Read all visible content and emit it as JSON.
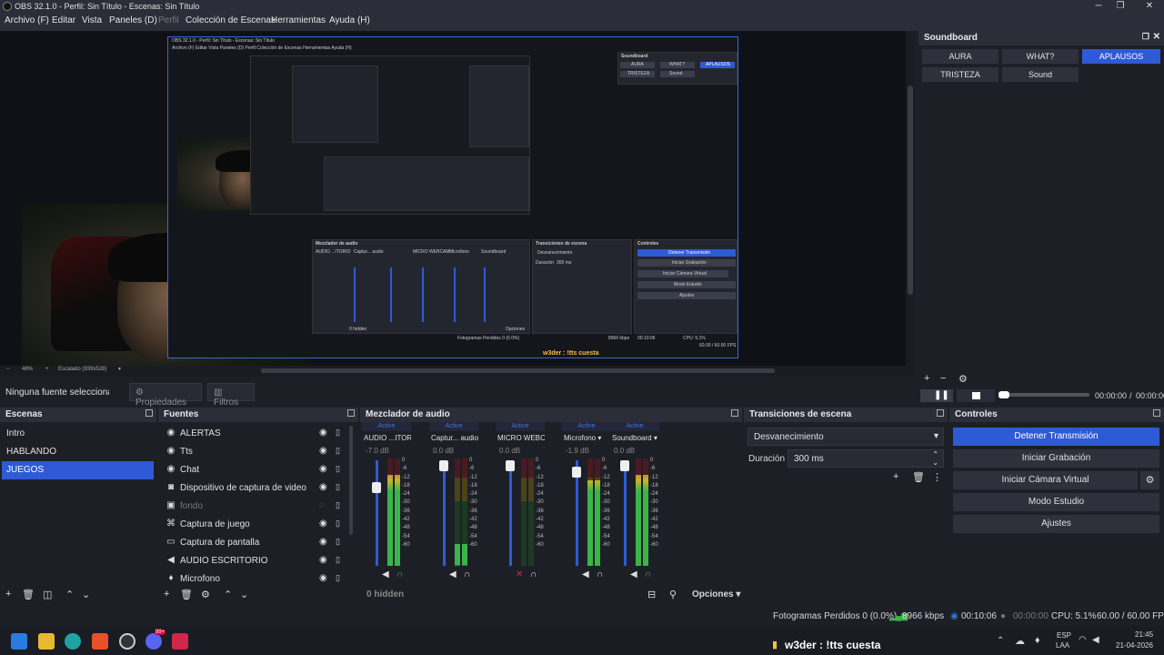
{
  "window": {
    "title": "OBS 32.1.0 - Perfil: Sin Título - Escenas: Sin Título",
    "minimize": "─",
    "maximize": "❐",
    "close": "✕"
  },
  "menu": {
    "items": [
      "Archivo (F)",
      "Editar",
      "Vista",
      "Paneles (D)",
      "Perfil",
      "Colección de Escenas",
      "Herramientas",
      "Ayuda (H)"
    ]
  },
  "preview": {
    "zoom": "48%",
    "zoom_minus": "−",
    "zoom_plus": "+",
    "scale_label": "Escalado (939x528)",
    "nested_title": "OBS 32.1.0 - Perfil: Sin Título - Escenas: Sin Título",
    "nested_menu": "Archivo (F)   Editar   Vista   Paneles (D)   Perfil   Colección de Escenas   Herramientas   Ayuda (H)",
    "nested_mixer_title": "Mezclador de audio",
    "nested_trans_title": "Transiciones de escena",
    "nested_controls_title": "Controles",
    "nested_stop": "Detener Transmisión",
    "nested_rec": "Iniciar Grabación",
    "nested_vcam": "Iniciar Cámara Virtual",
    "nested_studio": "Modo Estudio",
    "nested_settings": "Ajustes",
    "nested_soundboard": "Soundboard",
    "nested_aura": "AURA",
    "nested_what": "WHAT?",
    "nested_aplausos": "APLAUSOS",
    "nested_tristeza": "TRISTEZA",
    "nested_sound": "Sound",
    "nested_fade": "Desvanecimiento",
    "nested_duration": "Duración",
    "nested_duration_val": "300 ms",
    "nested_hidden": "0 hidden",
    "nested_options": "Opciones",
    "nested_dropped": "Fotogramas Perdidos 0 (0.0%)",
    "nested_kbps": "8966 kbps",
    "nested_time": "00:10:06",
    "nested_cpu": "CPU: 5.1%",
    "nested_fps": "60.00 / 60.00 FPS",
    "nested_channels": [
      "AUDIO ...ITORIO",
      "Captur... audio",
      "MICRO WEBCAM",
      "Microfono",
      "Soundboard"
    ],
    "overlay_text": "w3der : !tts cuesta"
  },
  "source_toolbar": {
    "no_source": "Ninguna fuente seleccionada",
    "properties": "Propiedades",
    "filters": "Filtros"
  },
  "soundboard": {
    "title": "Soundboard",
    "buttons": [
      "AURA",
      "WHAT?",
      "APLAUSOS",
      "TRISTEZA",
      "Sound"
    ]
  },
  "media": {
    "time": "00:00:00",
    "sep": "/",
    "duration": "00:00:00"
  },
  "scenes": {
    "title": "Escenas",
    "items": [
      "Intro",
      "HABLANDO",
      "JUEGOS"
    ],
    "selected": "JUEGOS"
  },
  "sources": {
    "title": "Fuentes",
    "items": [
      {
        "label": "ALERTAS",
        "icon": "globe-icon",
        "glyph": "◉",
        "visible": true
      },
      {
        "label": "Tts",
        "icon": "globe-icon",
        "glyph": "◉",
        "visible": true
      },
      {
        "label": "Chat",
        "icon": "globe-icon",
        "glyph": "◉",
        "visible": true
      },
      {
        "label": "Dispositivo de captura de video",
        "icon": "camera-icon",
        "glyph": "◙",
        "visible": true
      },
      {
        "label": "fondo",
        "icon": "image-icon",
        "glyph": "▣",
        "visible": false
      },
      {
        "label": "Captura de juego",
        "icon": "gamepad-icon",
        "glyph": "⌘",
        "visible": true
      },
      {
        "label": "Captura de pantalla",
        "icon": "monitor-icon",
        "glyph": "▭",
        "visible": true
      },
      {
        "label": "AUDIO ESCRITORIO",
        "icon": "speaker-icon",
        "glyph": "◀",
        "visible": true
      },
      {
        "label": "Microfono",
        "icon": "microphone-icon",
        "glyph": "♦",
        "visible": true
      }
    ]
  },
  "mixer": {
    "title": "Mezclador de audio",
    "active_label": "Active",
    "scale": [
      "0",
      "-6",
      "-12",
      "-18",
      "-24",
      "-30",
      "-36",
      "-42",
      "-48",
      "-54",
      "-60"
    ],
    "channels": [
      {
        "name": "AUDIO ...ITORIO",
        "db": "-7.0 dB",
        "fader_level": 0.77,
        "level": 0.85,
        "muted": false
      },
      {
        "name": "Captur... audio",
        "db": "0.0 dB",
        "fader_level": 1.0,
        "level": 0.2,
        "muted": false
      },
      {
        "name": "MICRO WEBCAM",
        "db": "0.0 dB",
        "fader_level": 1.0,
        "level": 0.0,
        "muted": true
      },
      {
        "name": "Microfono",
        "db": "-1.9 dB",
        "fader_level": 0.93,
        "level": 0.8,
        "muted": false
      },
      {
        "name": "Soundboard",
        "db": "0.0 dB",
        "fader_level": 1.0,
        "level": 0.85,
        "muted": false
      }
    ],
    "hidden": "0 hidden",
    "options": "Opciones"
  },
  "transitions": {
    "title": "Transiciones de escena",
    "selected": "Desvanecimiento",
    "duration_label": "Duración",
    "duration_value": "300 ms"
  },
  "controls": {
    "title": "Controles",
    "stop_stream": "Detener Transmisión",
    "start_recording": "Iniciar Grabación",
    "start_vcam": "Iniciar Cámara Virtual",
    "studio_mode": "Modo Estudio",
    "settings": "Ajustes"
  },
  "status": {
    "dropped": "Fotogramas Perdidos 0 (0.0%)",
    "kbps": "8966 kbps",
    "stream_time": "00:10:06",
    "rec_time": "00:00:00",
    "cpu": "CPU: 5.1%",
    "fps": "60.00 / 60.00 FPS"
  },
  "taskbar": {
    "chat_overlay": "w3der : !tts cuesta",
    "lang": "ESP",
    "layout": "LAA",
    "time": "21:45",
    "date": "21-04-2026",
    "badge": "99+"
  },
  "colors": {
    "accent": "#2f5ad6",
    "bg": "#1d1f26",
    "header": "#2b2e38",
    "meter_green": "#3bb44a",
    "meter_yellow": "#c8b42a",
    "meter_red": "#b8283a"
  }
}
